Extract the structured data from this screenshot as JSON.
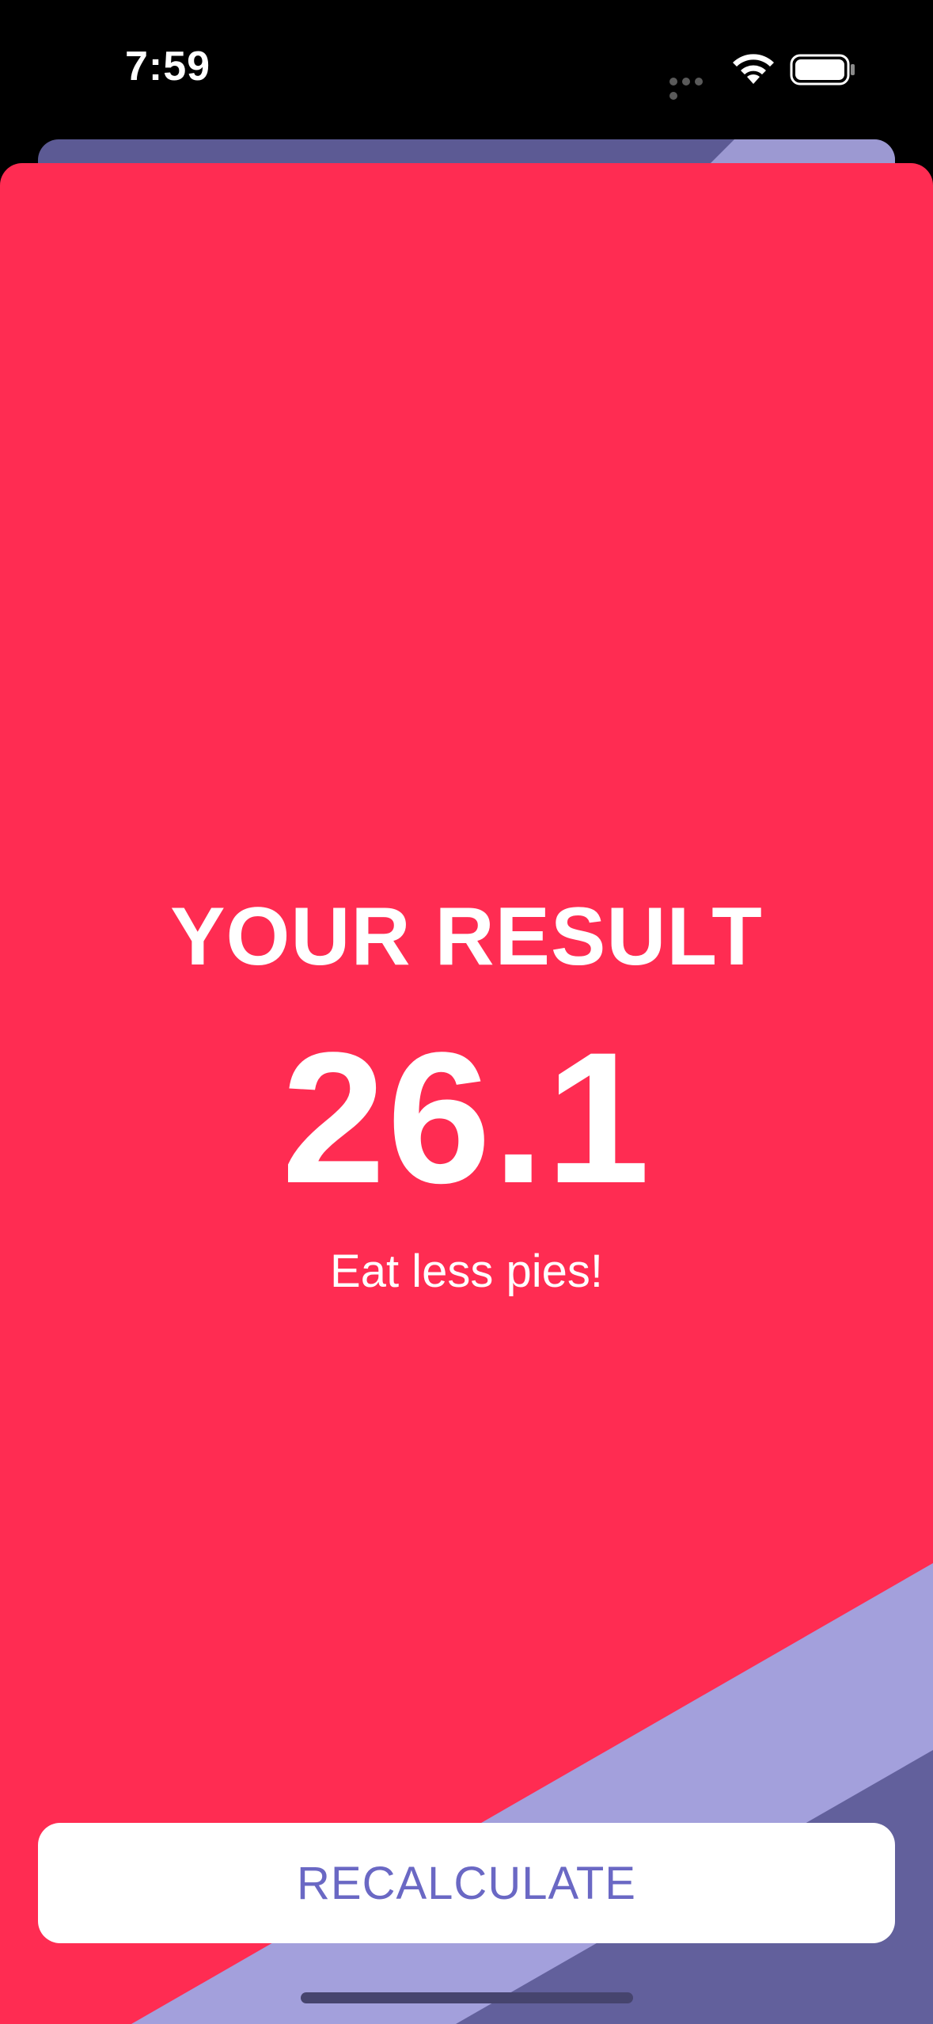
{
  "status_bar": {
    "time": "7:59",
    "icons": [
      "signal-dots-icon",
      "wifi-icon",
      "battery-icon"
    ]
  },
  "result": {
    "title": "YOUR RESULT",
    "value": "26.1",
    "advice": "Eat less pies!"
  },
  "actions": {
    "recalculate_label": "RECALCULATE"
  },
  "colors": {
    "card_background": "#ff2c52",
    "decor_light": "#a3a0dc",
    "decor_dark": "#62609c",
    "button_background": "#ffffff",
    "button_text": "#6a68c4",
    "text": "#ffffff"
  }
}
